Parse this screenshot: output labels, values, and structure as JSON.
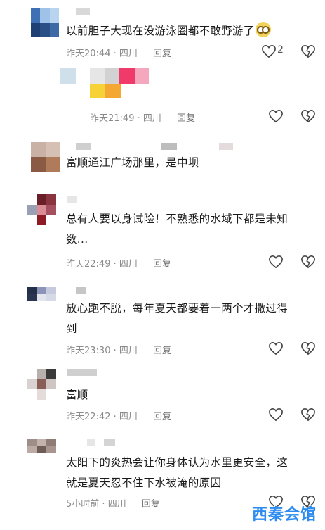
{
  "comments": [
    {
      "text": "以前胆子大现在没游泳圈都不敢野游了",
      "time": "昨天20:44",
      "location": "四川",
      "reply_label": "回复",
      "like_count": "2"
    },
    {
      "time": "昨天21:49",
      "location": "四川",
      "reply_label": "回复"
    },
    {
      "text": "富顺通江广场那里，是中坝"
    },
    {
      "text_line1": "总有人要以身试险！不熟悉的水域下都是未知",
      "text_line2": "数...",
      "time": "昨天22:49",
      "location": "四川",
      "reply_label": "回复"
    },
    {
      "text_line1": "放心跑不脱，每年夏天都要着一两个才撒过得",
      "text_line2": "到",
      "time": "昨天23:30",
      "location": "四川",
      "reply_label": "回复"
    },
    {
      "text": "富顺",
      "time": "昨天22:42",
      "location": "四川",
      "reply_label": "回复"
    },
    {
      "text_line1": "太阳下的炎热会让你身体认为水里更安全，这",
      "text_line2": "就是夏天忍不住下水被淹的原因",
      "time": "5小时前",
      "location": "四川",
      "reply_label": "回复"
    }
  ],
  "separator": "·",
  "icons": {
    "like": "heart-outline-icon",
    "dislike": "broken-heart-outline-icon",
    "emoji": "dizzy-eyes-emoji-icon"
  },
  "watermark": "西秦会馆",
  "colors": {
    "text": "#1a1a1a",
    "meta": "#8a8a8a",
    "watermark": "#2d8cf0"
  }
}
